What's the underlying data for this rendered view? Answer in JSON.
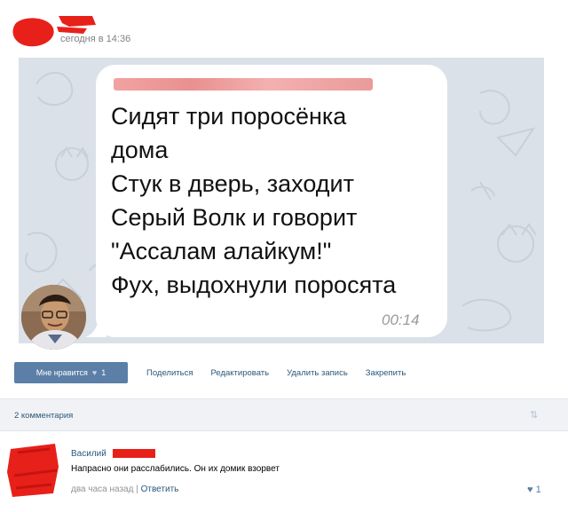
{
  "post": {
    "author_hidden": "",
    "time": "сегодня в 14:36"
  },
  "message": {
    "sender_hidden": "",
    "text": "Сидят три поросёнка\nдома\nСтук в дверь, заходит\nСерый Волк и говорит\n\"Ассалам алайкум!\"\nФух, выдохнули поросята",
    "time": "00:14"
  },
  "actions": {
    "like_label": "Мне нравится",
    "like_count": "1",
    "share": "Поделиться",
    "edit": "Редактировать",
    "delete": "Удалить запись",
    "pin": "Закрепить"
  },
  "comments": {
    "count_label": "2 комментария",
    "items": [
      {
        "name": "Василий",
        "text": "Напрасно они расслабились. Он их домик взорвет",
        "time": "два часа назад",
        "reply": "Ответить",
        "likes": "1"
      }
    ]
  },
  "icons": {
    "heart": "heart-icon",
    "sort": "sort-icon"
  },
  "colors": {
    "vk_blue": "#5b7fa6",
    "link": "#2b587a",
    "censor_red": "#e8201a"
  }
}
